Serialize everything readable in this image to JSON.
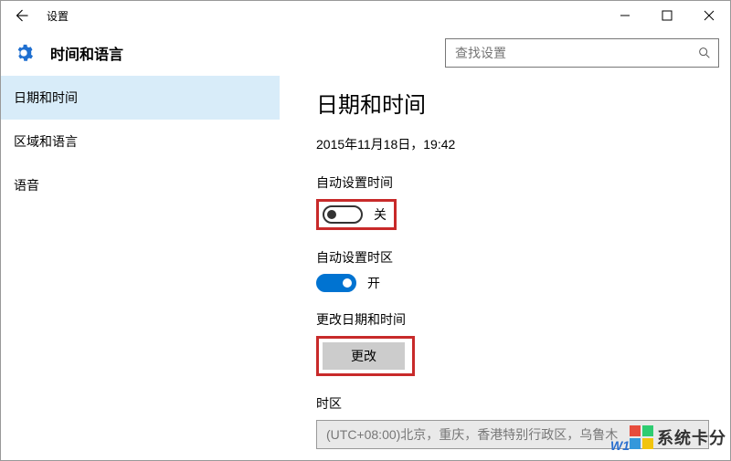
{
  "window": {
    "title": "设置"
  },
  "header": {
    "section_title": "时间和语言",
    "search_placeholder": "查找设置"
  },
  "sidebar": {
    "items": [
      {
        "label": "日期和时间",
        "active": true
      },
      {
        "label": "区域和语言",
        "active": false
      },
      {
        "label": "语音",
        "active": false
      }
    ]
  },
  "main": {
    "page_title": "日期和时间",
    "current_datetime": "2015年11月18日，19:42",
    "auto_time": {
      "label": "自动设置时间",
      "state_text": "关",
      "on": false
    },
    "auto_tz": {
      "label": "自动设置时区",
      "state_text": "开",
      "on": true
    },
    "change_dt": {
      "label": "更改日期和时间",
      "button": "更改"
    },
    "timezone": {
      "label": "时区",
      "value": "(UTC+08:00)北京，重庆，香港特别行政区，乌鲁木"
    }
  },
  "watermark": {
    "brand": "系统卡分",
    "sub": "W1"
  }
}
